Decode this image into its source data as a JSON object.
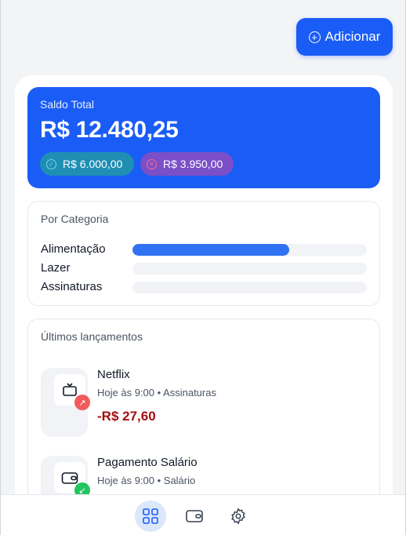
{
  "header": {
    "add_label": "Adicionar"
  },
  "balance": {
    "label": "Saldo Total",
    "amount": "R$ 12.480,25",
    "income": "R$ 6.000,00",
    "expense": "R$ 3.950,00"
  },
  "categories": {
    "title": "Por Categoria",
    "items": [
      {
        "name": "Alimentação",
        "fraction": 0.67
      },
      {
        "name": "Lazer",
        "fraction": 0
      },
      {
        "name": "Assinaturas",
        "fraction": 0
      }
    ]
  },
  "transactions": {
    "title": "Últimos lançamentos",
    "items": [
      {
        "name": "Netflix",
        "meta": "Hoje às 9:00 • Assinaturas",
        "amount": "-R$ 27,60",
        "direction": "out",
        "icon": "tv-icon"
      },
      {
        "name": "Pagamento Salário",
        "meta": "Hoje às 9:00 • Salário",
        "amount": "",
        "direction": "in",
        "icon": "wallet-icon"
      }
    ]
  },
  "nav": {
    "items": [
      "grid-icon",
      "wallet-icon",
      "settings-icon"
    ],
    "active": 0
  },
  "colors": {
    "accent": "#1a5cf6",
    "expense": "#a30f0f",
    "income_badge": "#22c55e",
    "expense_badge": "#f25b5b"
  }
}
